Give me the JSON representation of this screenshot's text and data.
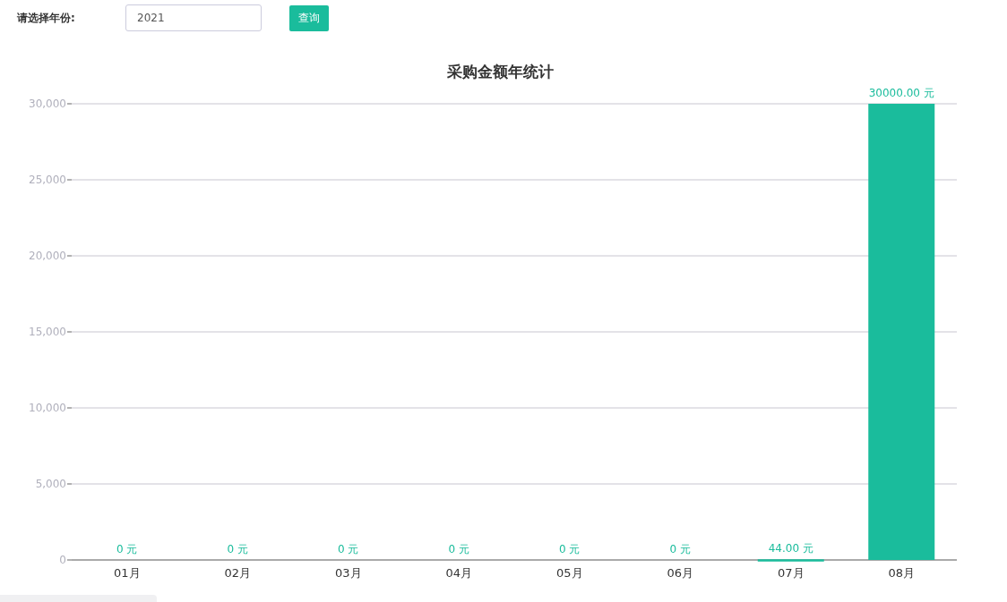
{
  "query_bar": {
    "label": "请选择年份:",
    "year_field": {
      "value": "2021"
    },
    "button": "查询"
  },
  "chart": {
    "chart_data": {
      "type": "bar",
      "title": "采购金额年统计",
      "categories": [
        "01月",
        "02月",
        "03月",
        "04月",
        "05月",
        "06月",
        "07月",
        "08月"
      ],
      "grid": true,
      "series": [
        {
          "color": "#1abc9c",
          "values": [
            0,
            0,
            0,
            0,
            0,
            0,
            44,
            30000
          ]
        }
      ],
      "ylim": [
        0,
        30000
      ],
      "yticks": [
        {
          "value": 0,
          "label": "0"
        },
        {
          "value": 5000,
          "label": "5,000"
        },
        {
          "value": 10000,
          "label": "10,000"
        },
        {
          "value": 15000,
          "label": "15,000"
        },
        {
          "value": 20000,
          "label": "20,000"
        },
        {
          "value": 25000,
          "label": "25,000"
        },
        {
          "value": 30000,
          "label": "30,000"
        }
      ],
      "value_labels": [
        "0 元",
        "0 元",
        "0 元",
        "0 元",
        "0 元",
        "0 元",
        "44.00 元",
        "30000.00 元"
      ]
    }
  }
}
